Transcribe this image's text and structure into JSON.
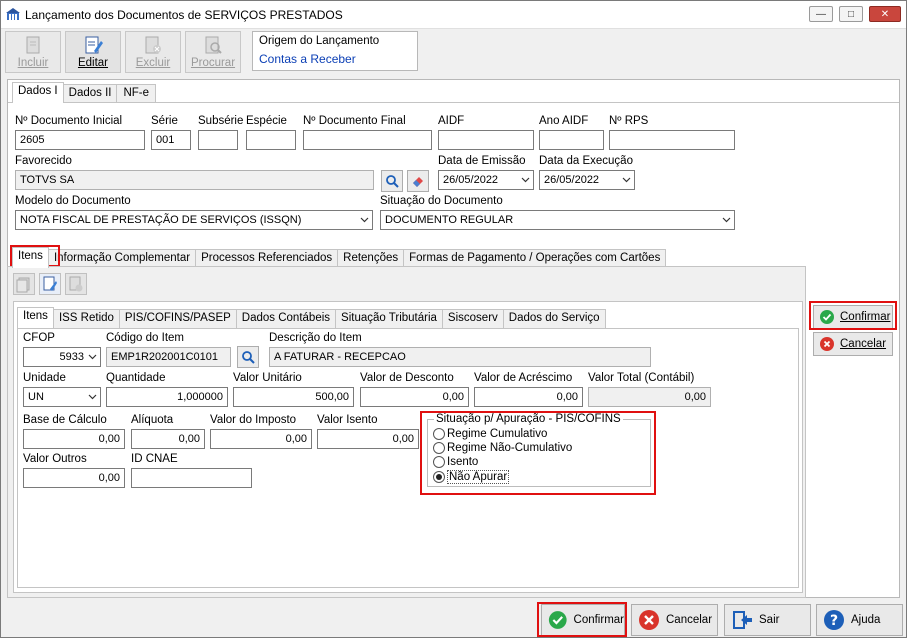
{
  "window": {
    "title": "Lançamento dos Documentos de SERVIÇOS PRESTADOS",
    "controls": {
      "minimize": "—",
      "maximize": "□",
      "close": "✕"
    }
  },
  "toolbar": {
    "incluir": "Incluir",
    "editar": "Editar",
    "excluir": "Excluir",
    "procurar": "Procurar"
  },
  "origem": {
    "label": "Origem do Lançamento",
    "value": "Contas a Receber"
  },
  "main_tabs": [
    "Dados I",
    "Dados II",
    "NF-e"
  ],
  "header_fields": {
    "doc_inicial_label": "Nº Documento Inicial",
    "doc_inicial_value": "2605",
    "serie_label": "Série",
    "serie_value": "001",
    "subserie_label": "Subsérie",
    "especie_label": "Espécie",
    "doc_final_label": "Nº Documento Final",
    "aidf_label": "AIDF",
    "ano_aidf_label": "Ano AIDF",
    "rps_label": "Nº RPS",
    "favorecido_label": "Favorecido",
    "favorecido_value": "TOTVS SA",
    "data_emissao_label": "Data de Emissão",
    "data_emissao_value": "26/05/2022",
    "data_execucao_label": "Data da Execução",
    "data_execucao_value": "26/05/2022",
    "modelo_label": "Modelo do Documento",
    "modelo_value": "NOTA FISCAL DE PRESTAÇÃO DE SERVIÇOS (ISSQN)",
    "situacao_label": "Situação do Documento",
    "situacao_value": "DOCUMENTO REGULAR"
  },
  "sub_tabs": [
    "Itens",
    "Informação Complementar",
    "Processos Referenciados",
    "Retenções",
    "Formas de Pagamento / Operações com Cartões"
  ],
  "item_tabs": [
    "Itens",
    "ISS Retido",
    "PIS/COFINS/PASEP",
    "Dados Contábeis",
    "Situação Tributária",
    "Siscoserv",
    "Dados do Serviço"
  ],
  "item_fields": {
    "cfop_label": "CFOP",
    "cfop_value": "5933",
    "codigo_item_label": "Código do Item",
    "codigo_item_value": "EMP1R202001C0101",
    "descricao_label": "Descrição do Item",
    "descricao_value": "A FATURAR  -  RECEPCAO",
    "unidade_label": "Unidade",
    "unidade_value": "UN",
    "quantidade_label": "Quantidade",
    "quantidade_value": "1,000000",
    "valor_unitario_label": "Valor Unitário",
    "valor_unitario_value": "500,00",
    "valor_desconto_label": "Valor de Desconto",
    "valor_desconto_value": "0,00",
    "valor_acrescimo_label": "Valor de Acréscimo",
    "valor_acrescimo_value": "0,00",
    "valor_total_label": "Valor Total (Contábil)",
    "valor_total_value": "0,00",
    "base_calculo_label": "Base de Cálculo",
    "base_calculo_value": "0,00",
    "aliquota_label": "Alíquota",
    "aliquota_value": "0,00",
    "valor_imposto_label": "Valor do Imposto",
    "valor_imposto_value": "0,00",
    "valor_isento_label": "Valor Isento",
    "valor_isento_value": "0,00",
    "valor_outros_label": "Valor Outros",
    "valor_outros_value": "0,00",
    "id_cnae_label": "ID CNAE"
  },
  "apuracao": {
    "title": "Situação p/ Apuração - PIS/COFINS",
    "options": [
      "Regime Cumulativo",
      "Regime Não-Cumulativo",
      "Isento",
      "Não Apurar"
    ],
    "selected": "Não Apurar"
  },
  "side_buttons": {
    "confirmar": "Confirmar",
    "cancelar": "Cancelar"
  },
  "bottom_buttons": {
    "confirmar": "Confirmar",
    "cancelar": "Cancelar",
    "sair": "Sair",
    "ajuda": "Ajuda"
  },
  "colors": {
    "highlight": "#e01010",
    "confirm": "#2aa84a",
    "cancel": "#d9342b",
    "link": "#0b3fb5"
  }
}
